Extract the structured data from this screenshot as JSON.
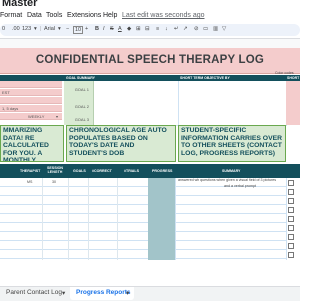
{
  "app": {
    "doc_title": "Master",
    "menu": [
      "Format",
      "Data",
      "Tools",
      "Extensions",
      "Help"
    ],
    "last_edit": "Last edit was seconds ago"
  },
  "toolbar": {
    "zoom": "0",
    "decimals": ".00",
    "format": "123",
    "font": "Arial",
    "font_size": "10",
    "bold": "B",
    "italic": "I",
    "strike": "S",
    "text_color": "A"
  },
  "sheet": {
    "title": "CONFIDENTIAL SPEECH THERAPY LOG",
    "color_codes": "Color codes",
    "goal_summary_header": "GOAL SUMMARY",
    "sto_header": "SHORT TERM OBJECTIVE BY",
    "short_header": "SHORT",
    "fields": [
      "",
      "EST",
      "",
      "1, 5 days",
      "WEEKLY"
    ],
    "goals": [
      "GOAL 1",
      "GOAL 2",
      "GOAL 3"
    ],
    "notes": [
      "MMARIZING DATA! RE CALCULATED FOR YOU. A MONTHLY SESSION COUNT TO EASILY KEEP VICES",
      "CHRONOLOGICAL AGE AUTO POPULATES BASED ON TODAY'S DATE AND STUDENT'S DOB",
      "STUDENT-SPECIFIC INFORMATION CARRIES OVER TO OTHER SHEETS (CONTACT LOG, PROGRESS REPORTS)"
    ],
    "table_headers": [
      "THERAPIST",
      "SESSION LENGTH",
      "GOALS",
      "#CORRECT",
      "#TRIALS",
      "PROGRESS",
      "SUMMARY"
    ],
    "rows": [
      {
        "therapist": "MS",
        "length": "30",
        "summary": "answered wh questions when given a visual field of 3 pictures"
      }
    ],
    "row_summary_2": "and a verbal prompt"
  },
  "tabs": [
    "Parent Contact Log",
    "Progress Reports"
  ],
  "colors": {
    "accent_pink": "#f4cccc",
    "accent_teal": "#134f5c",
    "accent_green": "#d9ead3"
  }
}
